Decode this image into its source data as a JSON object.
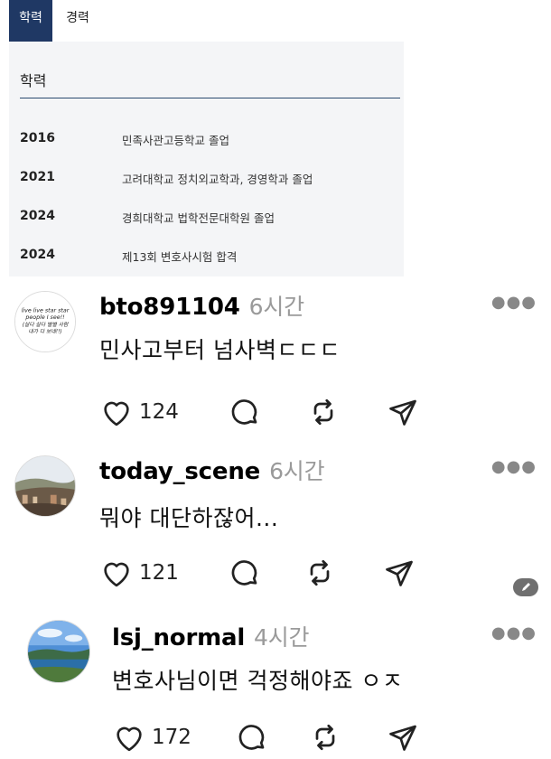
{
  "education_card": {
    "tabs": [
      {
        "label": "학력",
        "active": true
      },
      {
        "label": "경력",
        "active": false
      }
    ],
    "heading": "학력",
    "rows": [
      {
        "year": "2016",
        "desc": "민족사관고등학교 졸업"
      },
      {
        "year": "2021",
        "desc": "고려대학교 정치외교학과, 경영학과 졸업"
      },
      {
        "year": "2024",
        "desc": "경희대학교 법학전문대학원 졸업"
      },
      {
        "year": "2024",
        "desc": "제13회 변호사시험 합격"
      }
    ],
    "colors": {
      "tab_active_bg": "#1f3864",
      "rule": "#2b4a6f",
      "card_bg": "#f4f5f7"
    }
  },
  "comments": [
    {
      "username": "bto891104",
      "time": "6시간",
      "text": "민사고부터 넘사벽ㄷㄷㄷ",
      "likes": "124",
      "avatar_text": [
        "live live star star",
        "people I see!!",
        "(살다 살다 별별 사람",
        "내가 다 보네!!)"
      ],
      "more_icon": "more-horizontal-icon"
    },
    {
      "username": "today_scene",
      "time": "6시간",
      "text": "뭐야 대단하잖어...",
      "likes": "121",
      "more_icon": "more-horizontal-icon"
    },
    {
      "username": "lsj_normal",
      "time": "4시간",
      "text": "변호사님이면 걱정해야죠 ㅇㅈ",
      "likes": "172",
      "more_icon": "more-horizontal-icon"
    }
  ],
  "icons": {
    "like": "heart-icon",
    "reply": "comment-bubble-icon",
    "repost": "repost-icon",
    "share": "send-icon",
    "edit_badge": "pencil-icon"
  }
}
